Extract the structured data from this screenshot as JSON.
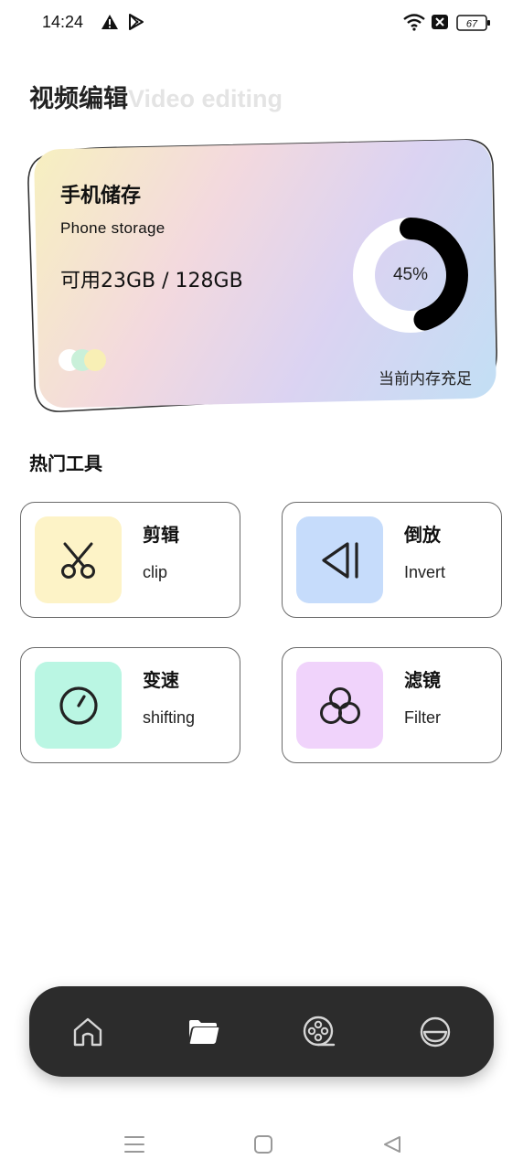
{
  "status_bar": {
    "time": "14:24",
    "icons": [
      "warning-icon",
      "play-store-icon",
      "wifi-icon",
      "sim-off-icon",
      "battery-icon"
    ],
    "battery_level": "67"
  },
  "header": {
    "title": "视频编辑",
    "subtitle": "Video editing"
  },
  "storage": {
    "title": "手机储存",
    "subtitle": "Phone  storage",
    "usage": "可用23GB / 128GB",
    "percent_label": "45%",
    "percent_value": 45,
    "status": "当前内存充足",
    "dot_colors": [
      "#ffffff",
      "#c9f0d9",
      "#f8efb5"
    ]
  },
  "tools": {
    "section_title": "热门工具",
    "items": [
      {
        "name": "剪辑",
        "en": "clip",
        "icon": "scissors-icon",
        "bg": "#fdf3c7"
      },
      {
        "name": "倒放",
        "en": "Invert",
        "icon": "rewind-icon",
        "bg": "#c6dcfb"
      },
      {
        "name": "变速",
        "en": "shifting",
        "icon": "speedometer-icon",
        "bg": "#baf6e3"
      },
      {
        "name": "滤镜",
        "en": "Filter",
        "icon": "filter-icon",
        "bg": "#f0d3fb"
      }
    ]
  },
  "bottom_nav": {
    "items": [
      "home-icon",
      "folder-icon",
      "film-reel-icon",
      "profile-icon"
    ],
    "active_index": 1,
    "background": "#2c2c2c"
  },
  "system_nav": [
    "menu-icon",
    "home-square-icon",
    "back-icon"
  ]
}
